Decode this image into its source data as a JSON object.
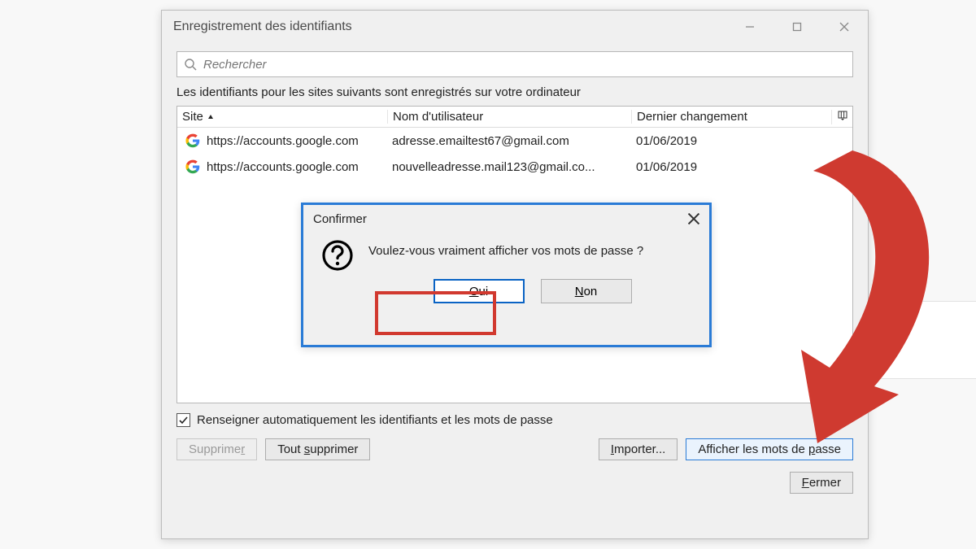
{
  "window": {
    "title": "Enregistrement des identifiants"
  },
  "search": {
    "placeholder": "Rechercher"
  },
  "description": "Les identifiants pour les sites suivants sont enregistrés sur votre ordinateur",
  "table": {
    "headers": {
      "site": "Site",
      "user": "Nom d'utilisateur",
      "date": "Dernier changement"
    },
    "rows": [
      {
        "site": "https://accounts.google.com",
        "user": "adresse.emailtest67@gmail.com",
        "date": "01/06/2019"
      },
      {
        "site": "https://accounts.google.com",
        "user": "nouvelleadresse.mail123@gmail.co...",
        "date": "01/06/2019"
      }
    ]
  },
  "checkbox": {
    "label": "Renseigner automatiquement les identifiants et les mots de passe"
  },
  "buttons": {
    "delete": "Supprimer",
    "delete_accel": "r",
    "delete_all_pre": "Tout ",
    "delete_all_accel": "s",
    "delete_all_post": "upprimer",
    "import": "Importer...",
    "import_accel": "I",
    "show_passwords_pre": "Afficher les mots de ",
    "show_passwords_accel": "p",
    "show_passwords_post": "asse",
    "close": "Fermer",
    "close_accel": "F"
  },
  "dialog": {
    "title": "Confirmer",
    "message": "Voulez-vous vraiment afficher vos mots de passe ?",
    "yes": "Oui",
    "yes_accel": "O",
    "no": "Non",
    "no_accel": "N"
  }
}
